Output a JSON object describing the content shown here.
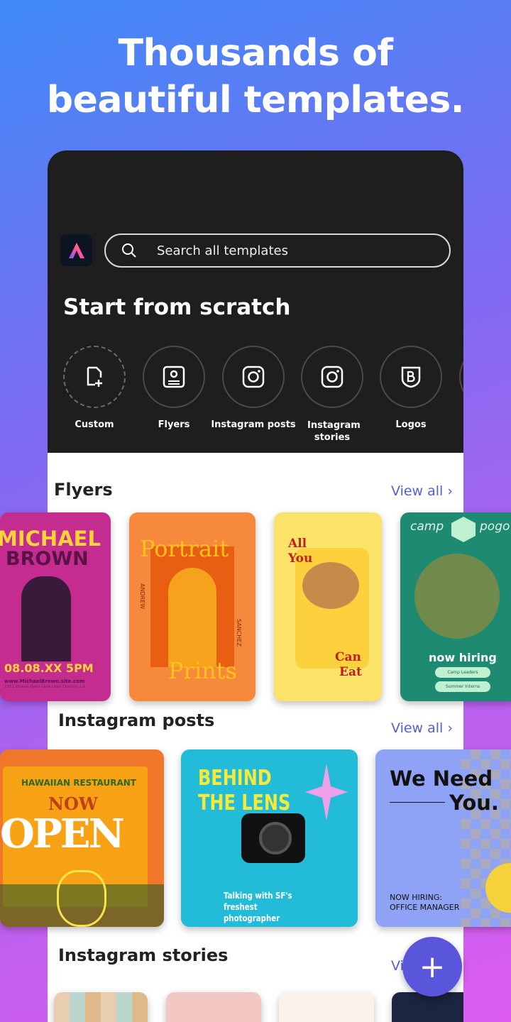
{
  "headline": {
    "line1": "Thousands of",
    "line2": "beautiful templates."
  },
  "search": {
    "placeholder": "Search all templates"
  },
  "scratch": {
    "title": "Start from scratch",
    "items": [
      {
        "label": "Custom",
        "icon": "new-file-icon"
      },
      {
        "label": "Flyers",
        "icon": "flyer-icon"
      },
      {
        "label": "Instagram posts",
        "icon": "instagram-icon"
      },
      {
        "label": "Instagram stories",
        "icon": "instagram-icon"
      },
      {
        "label": "Logos",
        "icon": "logo-b-icon"
      }
    ]
  },
  "flyers": {
    "title": "Flyers",
    "view_all": "View all",
    "cards": [
      {
        "line1": "MICHAEL",
        "line2": "BROWN",
        "date": "08.08.XX 5PM",
        "url": "www.MichaelBrown.site.com",
        "address": "2701 Willow Oaks Lane Lake Charles, LA"
      },
      {
        "line1": "Portrait",
        "line2": "Prints",
        "left": "ANDREW",
        "right": "SANCHEZ"
      },
      {
        "line1": "All",
        "line2": "You",
        "line3": "Can",
        "line4": "Eat"
      },
      {
        "brand_left": "camp",
        "brand_right": "pogo",
        "headline": "now hiring",
        "btn1": "Camp Leaders",
        "btn2": "Summer Interns"
      }
    ]
  },
  "instagram_posts": {
    "title": "Instagram posts",
    "view_all": "View all",
    "cards": [
      {
        "line1": "HAWAIIAN RESTAURANT",
        "line2": "NOW",
        "line3": "OPEN"
      },
      {
        "line1": "BEHIND",
        "line2": "THE LENS",
        "caption": "Talking with SF's freshest photographer"
      },
      {
        "line1": "We Need",
        "line2": "You.",
        "caption1": "NOW HIRING:",
        "caption2": "OFFICE MANAGER"
      }
    ]
  },
  "instagram_stories": {
    "title": "Instagram stories",
    "view_all": "Vi"
  },
  "colors": {
    "accent": "#5a56dc",
    "dark": "#1e1e1e"
  }
}
